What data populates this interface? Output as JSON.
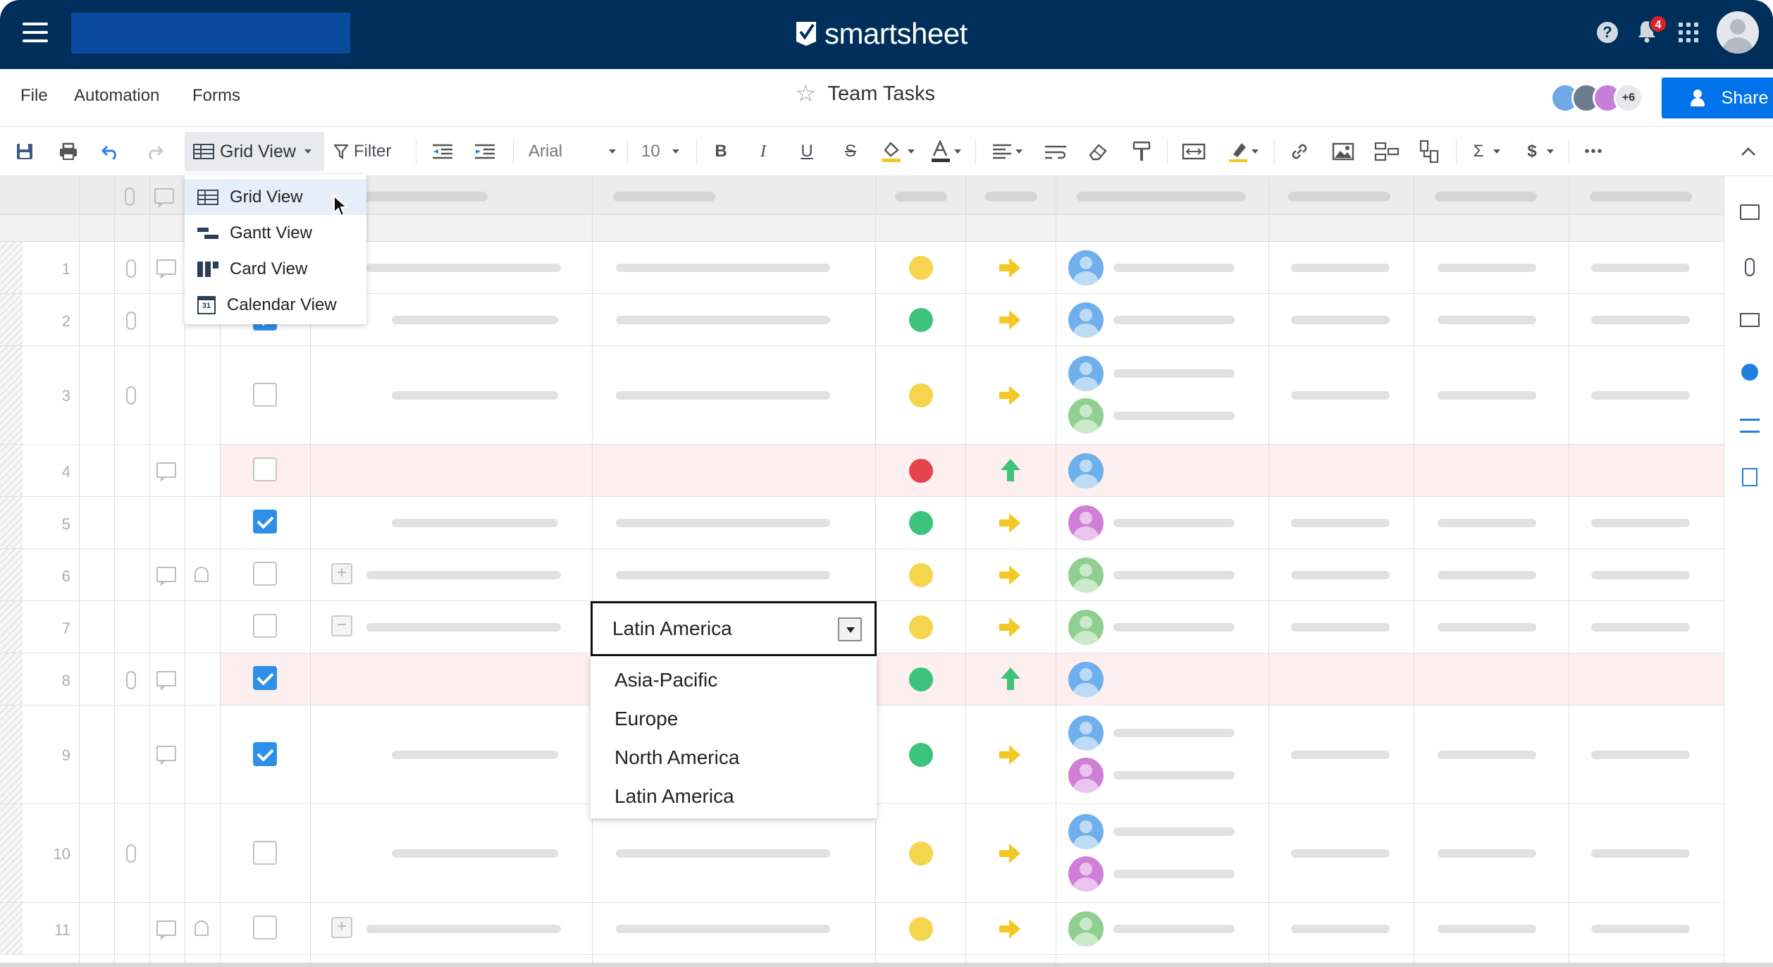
{
  "app": {
    "brand": "smartsheet"
  },
  "header": {
    "notification_count": "4"
  },
  "menu": {
    "items": [
      "File",
      "Automation",
      "Forms"
    ]
  },
  "sheet": {
    "title": "Team Tasks"
  },
  "collaborators": {
    "more_label": "+6"
  },
  "share": {
    "label": "Share"
  },
  "toolbar": {
    "view_label": "Grid View",
    "filter_label": "Filter",
    "font_family": "Arial",
    "font_size": "10",
    "bold": "B",
    "italic": "I",
    "underline": "U",
    "strike": "S",
    "sum": "Σ",
    "currency": "$",
    "more": "•••"
  },
  "views_menu": {
    "items": [
      {
        "label": "Grid View",
        "icon": "grid-icon",
        "selected": true
      },
      {
        "label": "Gantt View",
        "icon": "gantt-icon"
      },
      {
        "label": "Card View",
        "icon": "card-icon"
      },
      {
        "label": "Calendar View",
        "icon": "calendar-icon",
        "icon_text": "31"
      }
    ]
  },
  "rows": [
    {
      "num": "1",
      "status": "yellow",
      "trend": "right"
    },
    {
      "num": "2",
      "status": "green",
      "trend": "right",
      "done": true
    },
    {
      "num": "3",
      "status": "yellow",
      "trend": "right",
      "done": false
    },
    {
      "num": "4",
      "status": "red",
      "trend": "up",
      "done": false
    },
    {
      "num": "5",
      "status": "green",
      "trend": "right",
      "done": true
    },
    {
      "num": "6",
      "status": "yellow",
      "trend": "right",
      "done": false
    },
    {
      "num": "7",
      "status": "yellow",
      "trend": "right",
      "done": false
    },
    {
      "num": "8",
      "status": "green",
      "trend": "up",
      "done": true
    },
    {
      "num": "9",
      "status": "green",
      "trend": "right",
      "done": true
    },
    {
      "num": "10",
      "status": "yellow",
      "trend": "right",
      "done": false
    },
    {
      "num": "11",
      "status": "yellow",
      "trend": "right",
      "done": false
    }
  ],
  "region_dropdown": {
    "current_value": "Latin America",
    "options": [
      "Asia-Pacific",
      "Europe",
      "North America",
      "Latin America"
    ]
  },
  "colors": {
    "header_bg": "#002f5c",
    "accent": "#0073ea",
    "status_yellow": "#f5d44e",
    "status_green": "#3cc47c",
    "status_red": "#e2434d"
  }
}
